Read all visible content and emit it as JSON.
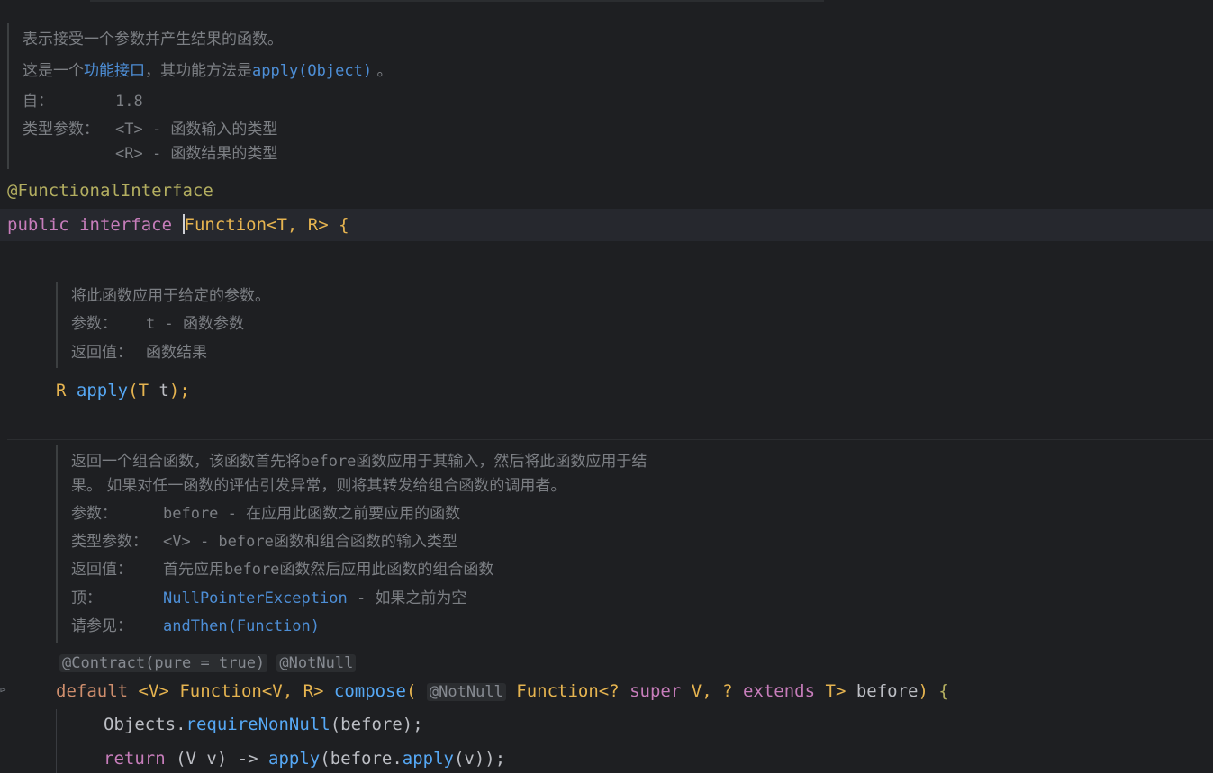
{
  "doc1": {
    "line1": "表示接受一个参数并产生结果的函数。",
    "line2_prefix": "这是一个",
    "line2_link": "功能接口",
    "line2_mid": "，其功能方法是",
    "line2_code": "apply(Object)",
    "line2_end": " 。",
    "since_label": "自：",
    "since_value": "1.8",
    "typeparams_label": "类型参数：",
    "tp1_code": "<T> - ",
    "tp1_text": "函数输入的类型",
    "tp2_code": "<R> - ",
    "tp2_text": "函数结果的类型"
  },
  "code_header": {
    "annotation": "@FunctionalInterface",
    "kw_public": "public",
    "kw_interface": "interface",
    "type_name": "Function",
    "generics": "<T, R>",
    "brace": "{"
  },
  "doc2": {
    "line1": "将此函数应用于给定的参数。",
    "params_label": "参数：",
    "param_code": "t - ",
    "param_text": "函数参数",
    "returns_label": "返回值：",
    "returns_text": "函数结果"
  },
  "apply_decl": {
    "ret_type": "R",
    "method": "apply",
    "open": "(",
    "ptype": "T",
    "pname": "t",
    "close": ");"
  },
  "doc3": {
    "line1_a": "返回一个组合函数，该函数首先将",
    "line1_code": "before",
    "line1_b": "函数应用于其输入，然后将此函数应用于结",
    "line2": "果。 如果对任一函数的评估引发异常，则将其转发给组合函数的调用者。",
    "params_label": "参数：",
    "param_code": "before - ",
    "param_text": "在应用此函数之前要应用的函数",
    "typeparams_label": "类型参数：",
    "tp_code": "<V> - before",
    "tp_text": "函数和组合函数的输入类型",
    "returns_label": "返回值：",
    "returns_a": "首先应用",
    "returns_code": "before",
    "returns_b": "函数然后应用此函数的组合函数",
    "throws_label": "顶：",
    "throws_link": "NullPointerException",
    "throws_dash": " - ",
    "throws_text": "如果之前为空",
    "see_label": "请参见：",
    "see_link": "andThen(Function)"
  },
  "compose": {
    "ann1": "@Contract(pure = true)",
    "ann2": "@NotNull",
    "kw_default": "default",
    "tparam": "<V>",
    "ret_type": "Function<V, R>",
    "method": "compose",
    "open": "(",
    "param_ann": "@NotNull",
    "ptype": "Function<?",
    "kw_super": "super",
    "ptype2": "V, ?",
    "kw_extends": "extends",
    "ptype3": "T>",
    "pname": "before",
    "close": ")",
    "brace": "{"
  },
  "body": {
    "objects": "Objects",
    "dot": ".",
    "require": "requireNonNull",
    "args": "(before);",
    "kw_return": "return",
    "lambda_a": "(V v) -> ",
    "apply": "apply",
    "lambda_b": "(before.",
    "apply2": "apply",
    "lambda_c": "(v));"
  },
  "colors": {
    "background": "#1e1f22",
    "keyword": "#cf8e6d",
    "annotation": "#b3ae60",
    "method": "#56a8f5",
    "doc_link": "#4d8ed6",
    "doc_text": "#7c7f84"
  }
}
